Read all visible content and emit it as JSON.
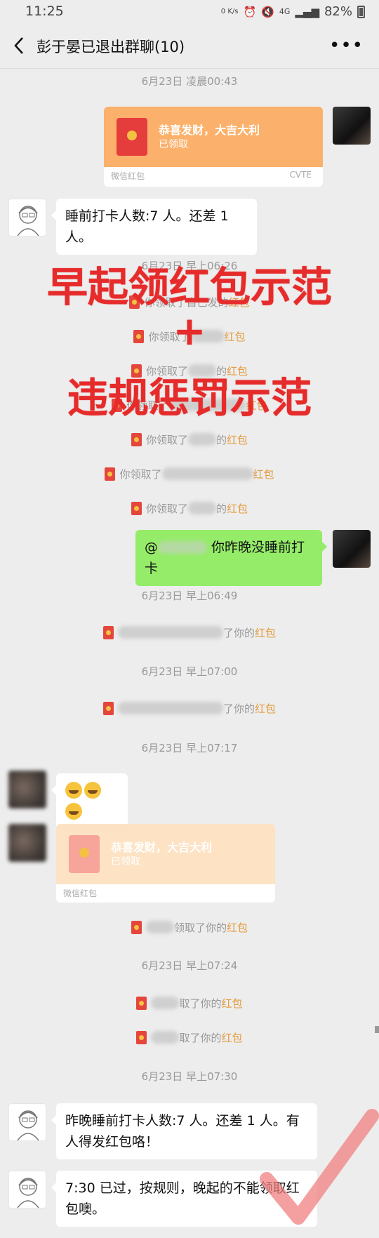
{
  "status": {
    "time": "11:25",
    "net": "0 K/s",
    "signal": "4G",
    "battery": "82%"
  },
  "header": {
    "title": "彭于晏已退出群聊(10)",
    "more": "•••"
  },
  "timestamps": [
    "6月23日 凌晨00:43",
    "6月23日 早上06:26",
    "6月23日 早上06:49",
    "6月23日 早上07:00",
    "6月23日 早上07:17",
    "6月23日 早上07:24",
    "6月23日 早上07:30"
  ],
  "redpacket1": {
    "title": "恭喜发财，大吉大利",
    "status": "已领取",
    "source": "微信红包",
    "tag": "CVTE"
  },
  "msg1": "睡前打卡人数:7 人。还差 1 人。",
  "overlay": {
    "line1": "早起领红包示范",
    "plus": "+",
    "line2": "违规惩罚示范"
  },
  "notices": [
    {
      "pre": "你领取了自己发的",
      "hl": "红包"
    },
    {
      "pre": "你领取了",
      "post": "",
      "hl": "红包"
    },
    {
      "pre": "你领取了",
      "post": "的",
      "hl": "红包"
    },
    {
      "pre": "你领取了",
      "post": "",
      "hl": "红包"
    },
    {
      "pre": "你领取了",
      "post": "的",
      "hl": "红包"
    },
    {
      "pre": "你领取了",
      "post": "",
      "hl": "红包"
    },
    {
      "pre": "你领取了",
      "post": "的",
      "hl": "红包"
    }
  ],
  "msg_green": {
    "at": "@",
    "text": "你昨晚没睡前打卡"
  },
  "notice_b1": {
    "post": "了你的",
    "hl": "红包"
  },
  "notice_b2": {
    "post": "了你的",
    "hl": "红包"
  },
  "redpacket2": {
    "title": "恭喜发财，大吉大利",
    "status": "已领取",
    "source": "微信红包"
  },
  "notice_c1": {
    "post": "领取了你的",
    "hl": "红包"
  },
  "notice_c2": {
    "post": "取了你的",
    "hl": "红包"
  },
  "notice_c3": {
    "post": "取了你的",
    "hl": "红包"
  },
  "msg2": "昨晚睡前打卡人数:7 人。还差 1 人。有人得发红包咯！",
  "msg3": "7:30 已过，按规则，晚起的不能领取红包噢。",
  "colors": {
    "bg": "#ededed",
    "green": "#95ec69",
    "red": "#e62b2b",
    "packet": "#fbb16b",
    "highlight": "#e39a3b"
  }
}
